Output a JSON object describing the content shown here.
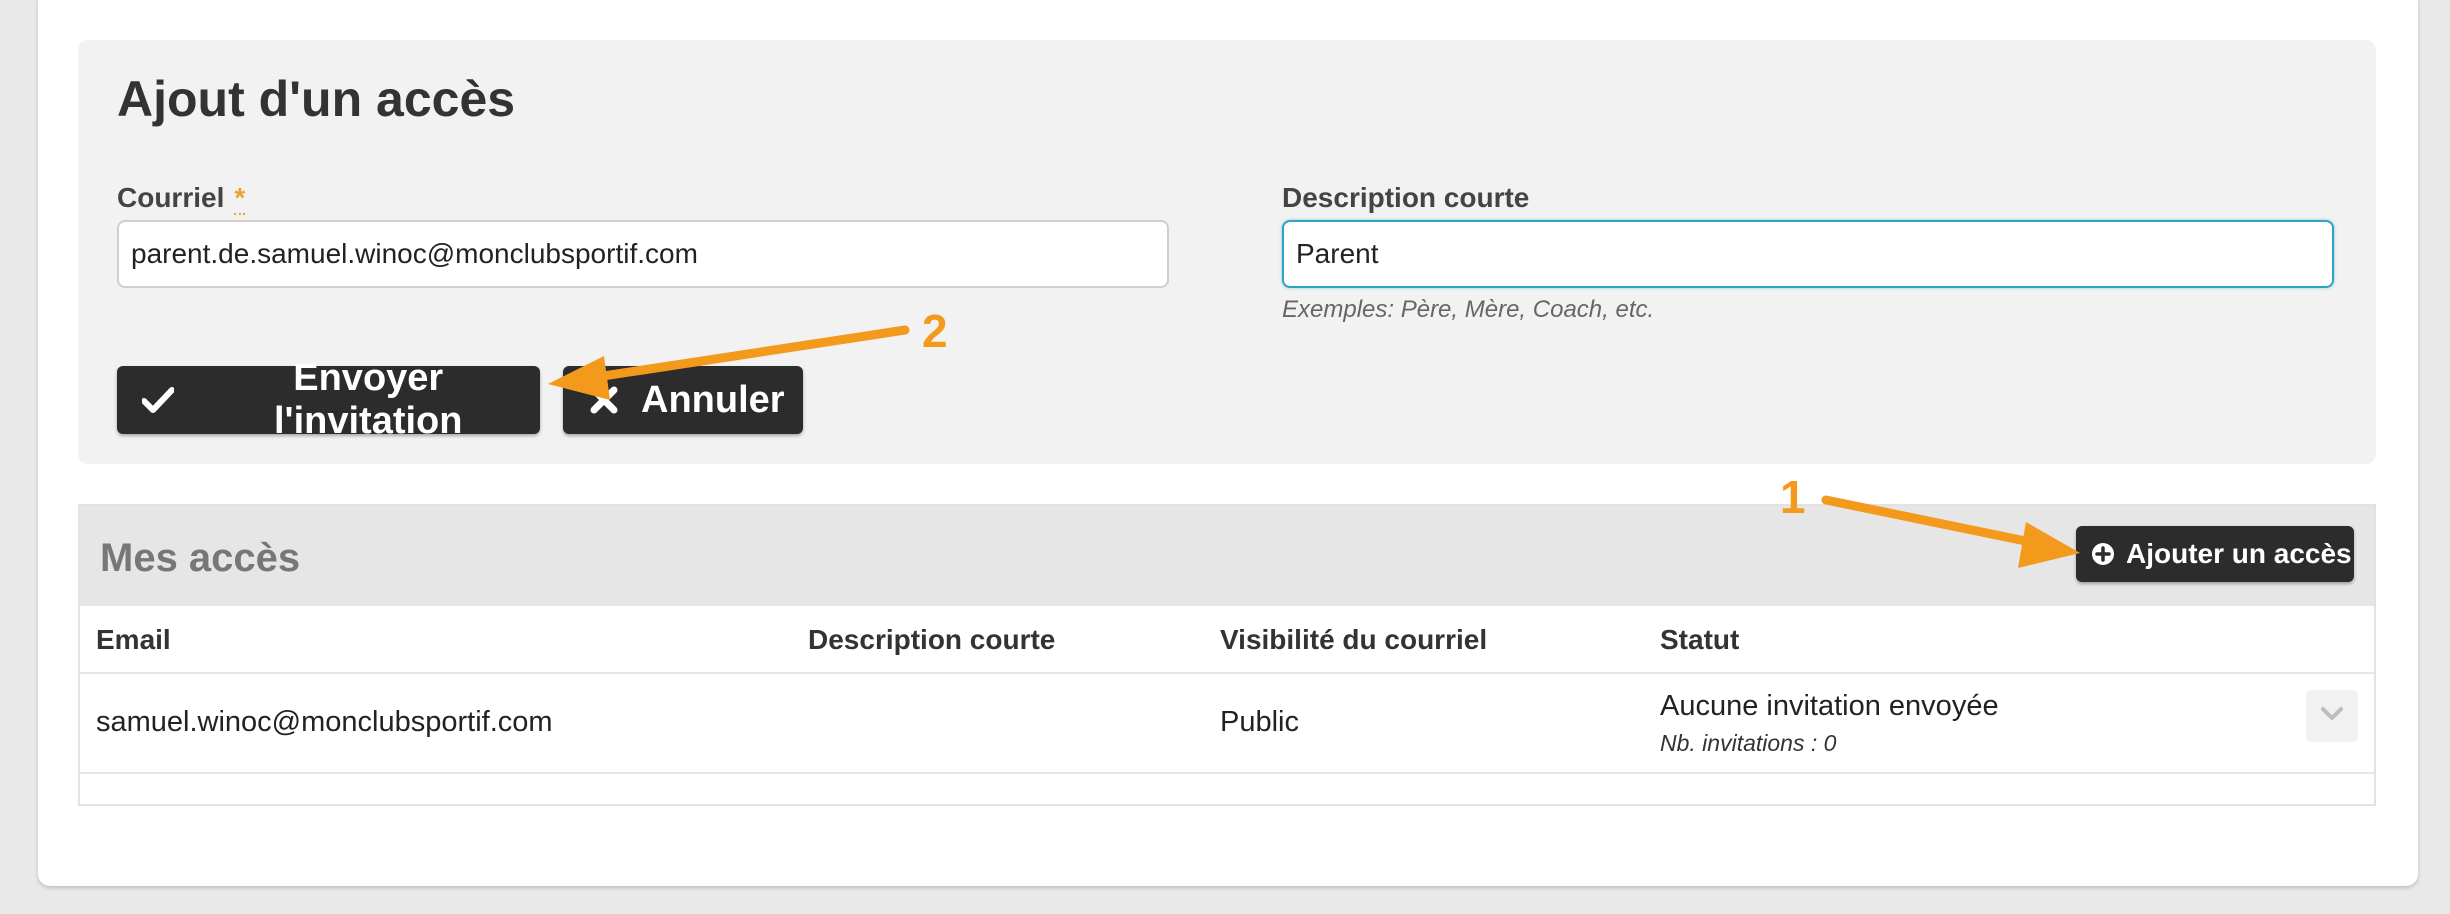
{
  "form": {
    "title": "Ajout d'un accès",
    "email_label": "Courriel",
    "required_marker": "*",
    "email_value": "parent.de.samuel.winoc@monclubsportif.com",
    "description_label": "Description courte",
    "description_value": "Parent",
    "description_hint": "Exemples: Père, Mère, Coach, etc.",
    "send_button": "Envoyer l'invitation",
    "cancel_button": "Annuler"
  },
  "access_list": {
    "title": "Mes accès",
    "add_button": "Ajouter un accès",
    "columns": [
      "Email",
      "Description courte",
      "Visibilité du courriel",
      "Statut"
    ],
    "rows": [
      {
        "email": "samuel.winoc@monclubsportif.com",
        "description": "",
        "visibility": "Public",
        "status": "Aucune invitation envoyée",
        "invitations": "Nb. invitations : 0"
      }
    ]
  },
  "annotations": {
    "step1": "1",
    "step2": "2",
    "color": "#f39a1c"
  },
  "colors": {
    "button_bg": "#2c2c2c",
    "focus_border": "#2ea3c7",
    "accent": "#f39a1c"
  }
}
